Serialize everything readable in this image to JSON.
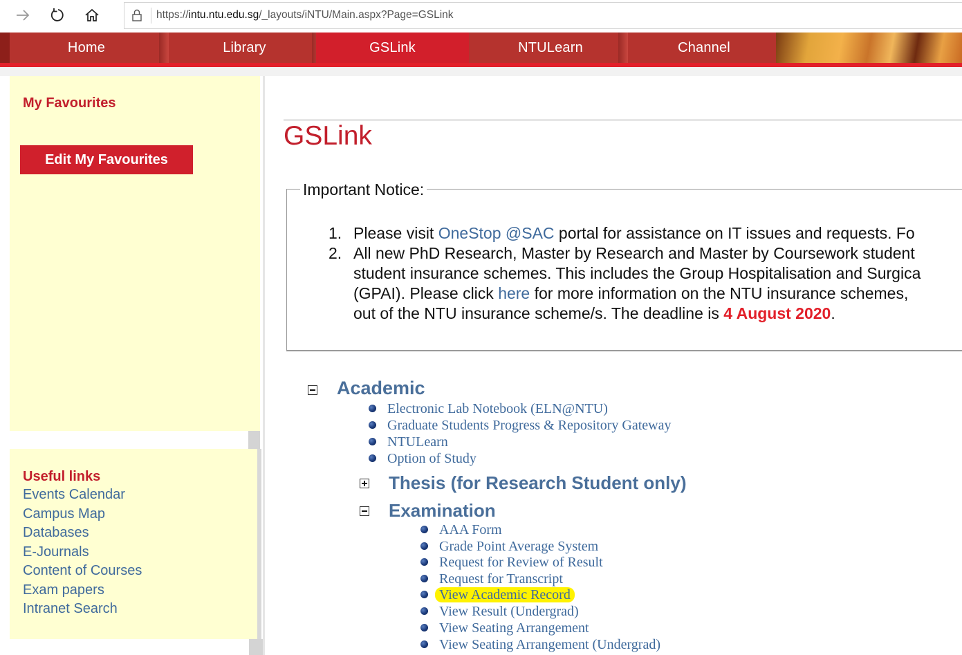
{
  "browser": {
    "url_prefix": "https://",
    "url_domain": "intu.ntu.edu.sg",
    "url_path": "/_layouts/iNTU/Main.aspx?Page=GSLink"
  },
  "topnav": {
    "tabs": [
      {
        "label": "Home"
      },
      {
        "label": "Library"
      },
      {
        "label": "GSLink",
        "active": true
      },
      {
        "label": "NTULearn"
      },
      {
        "label": "Channel"
      }
    ]
  },
  "sidebar": {
    "favourites_title": "My Favourites",
    "edit_favourites_label": "Edit My Favourites",
    "useful_links_title": "Useful links",
    "useful_links": [
      "Events Calendar",
      "Campus Map",
      "Databases",
      "E-Journals",
      "Content of Courses",
      "Exam papers",
      "Intranet Search"
    ]
  },
  "main": {
    "page_title": "GSLink",
    "notice": {
      "legend": "Important Notice:",
      "item1": {
        "num": "1.",
        "text_before": "Please visit ",
        "link": "OneStop @SAC",
        "text_after": " portal for assistance on IT issues and requests. Fo"
      },
      "item2": {
        "num": "2.",
        "line1": "All new PhD Research, Master by Research and Master by Coursework student",
        "line2": "student insurance schemes. This includes the Group Hospitalisation and Surgica",
        "line3_before": "(GPAI). Please click ",
        "line3_link": "here",
        "line3_after": " for more information on the NTU insurance schemes,",
        "line4_before": "out of the NTU insurance scheme/s. The deadline is ",
        "deadline": "4 August 2020",
        "line4_after": "."
      }
    },
    "tree": {
      "academic": {
        "title": "Academic",
        "items": [
          "Electronic Lab Notebook (ELN@NTU)",
          "Graduate Students Progress & Repository Gateway",
          "NTULearn",
          "Option of Study"
        ]
      },
      "thesis": {
        "title": "Thesis (for Research Student only)"
      },
      "examination": {
        "title": "Examination",
        "items": [
          "AAA Form",
          "Grade Point Average System",
          "Request for Review of Result",
          "Request for Transcript",
          "View Academic Record",
          "View Result (Undergrad)",
          "View Seating Arrangement",
          "View Seating Arrangement (Undergrad)"
        ],
        "highlighted_item": "View Academic Record"
      }
    }
  },
  "colors": {
    "accent_red": "#d21f2b",
    "nav_red": "#b5332e",
    "link_blue": "#3f6a9c",
    "sidebar_bg": "#ffffd2",
    "highlight": "#fff200"
  }
}
